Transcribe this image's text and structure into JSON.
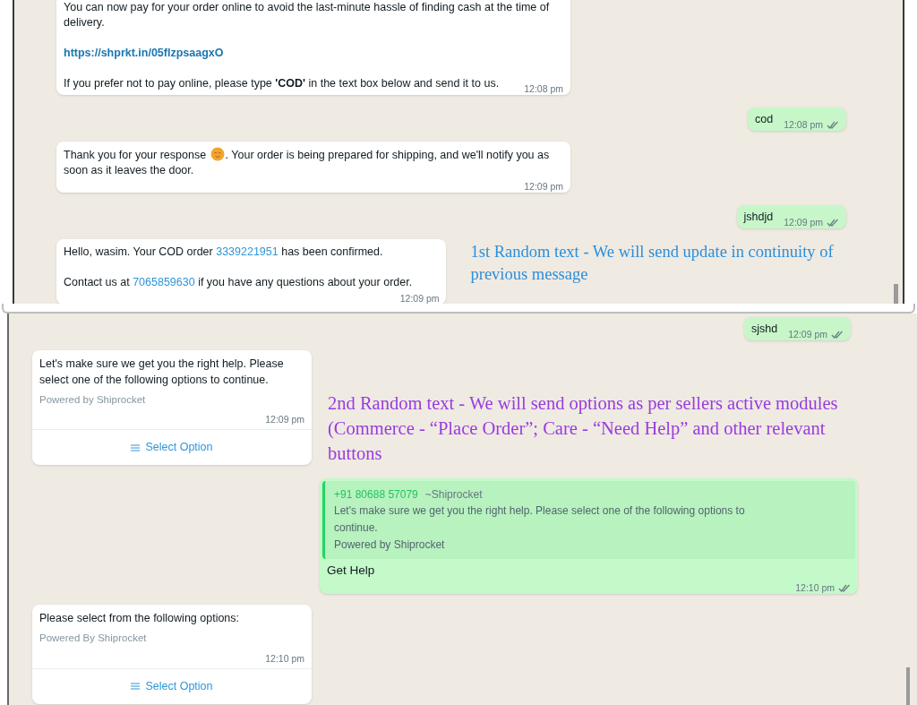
{
  "panels": [
    {
      "messages": [
        {
          "kind": "incoming",
          "paragraphs": [
            [
              {
                "kind": "text",
                "text": "You can now pay for your order online to avoid the last-minute hassle of finding cash at the time of delivery."
              }
            ],
            [
              {
                "kind": "url",
                "text": "https://shprkt.in/05flzpsaagxO"
              }
            ],
            [
              {
                "kind": "text",
                "text": "If you prefer not to pay online, please type **'COD'** in the text box below and send it to us."
              }
            ]
          ],
          "time": "12:08 pm"
        },
        {
          "kind": "outgoing",
          "text": "cod",
          "time": "12:08 pm"
        },
        {
          "kind": "incoming",
          "paragraphs": [
            [
              {
                "kind": "text",
                "text": "Thank you for your response "
              },
              {
                "kind": "emoji"
              },
              {
                "kind": "text",
                "text": ". Your order is being prepared for shipping, and we'll notify you as soon as it leaves the door."
              }
            ]
          ],
          "time": "12:09 pm"
        },
        {
          "kind": "outgoing",
          "text": "jshdjd",
          "time": "12:09 pm"
        },
        {
          "kind": "incoming",
          "paragraphs": [
            [
              {
                "kind": "text",
                "text": "Hello, wasim. Your COD order "
              },
              {
                "kind": "link",
                "text": "3339221951"
              },
              {
                "kind": "text",
                "text": " has been confirmed."
              }
            ],
            [
              {
                "kind": "text",
                "text": "Contact us at "
              },
              {
                "kind": "link",
                "text": "7065859630"
              },
              {
                "kind": "text",
                "text": " if you have any questions about your order."
              }
            ]
          ],
          "time": "12:09 pm",
          "note": {
            "text": "1st Random text - We will send update in continuity of previous message",
            "color": "#2b8fdc"
          }
        }
      ]
    },
    {
      "messages": [
        {
          "kind": "outgoing",
          "text": "sjshd",
          "time": "12:09 pm"
        },
        {
          "kind": "list",
          "text": "Let's make sure we get you the right help. Please select one of the following options to continue.",
          "footer": "Powered by Shiprocket",
          "time": "12:09 pm",
          "button": "Select Option",
          "note": {
            "text": "2nd Random text - We will send options as per sellers active modules (Commerce - “Place Order”; Care - “Need Help” and other relevant buttons",
            "color": "#9a3be0"
          }
        },
        {
          "kind": "reply",
          "quote": {
            "sender": "+91 80688 57079",
            "name": "~Shiprocket",
            "text": "Let's make sure we get you the right help. Please select one of the following options to continue.",
            "footer": "Powered by Shiprocket"
          },
          "text": "Get Help",
          "time": "12:10 pm"
        },
        {
          "kind": "list",
          "text": "Please select from the following options:",
          "footer": "Powered By Shiprocket",
          "time": "12:10 pm",
          "button": "Select Option"
        }
      ]
    }
  ]
}
